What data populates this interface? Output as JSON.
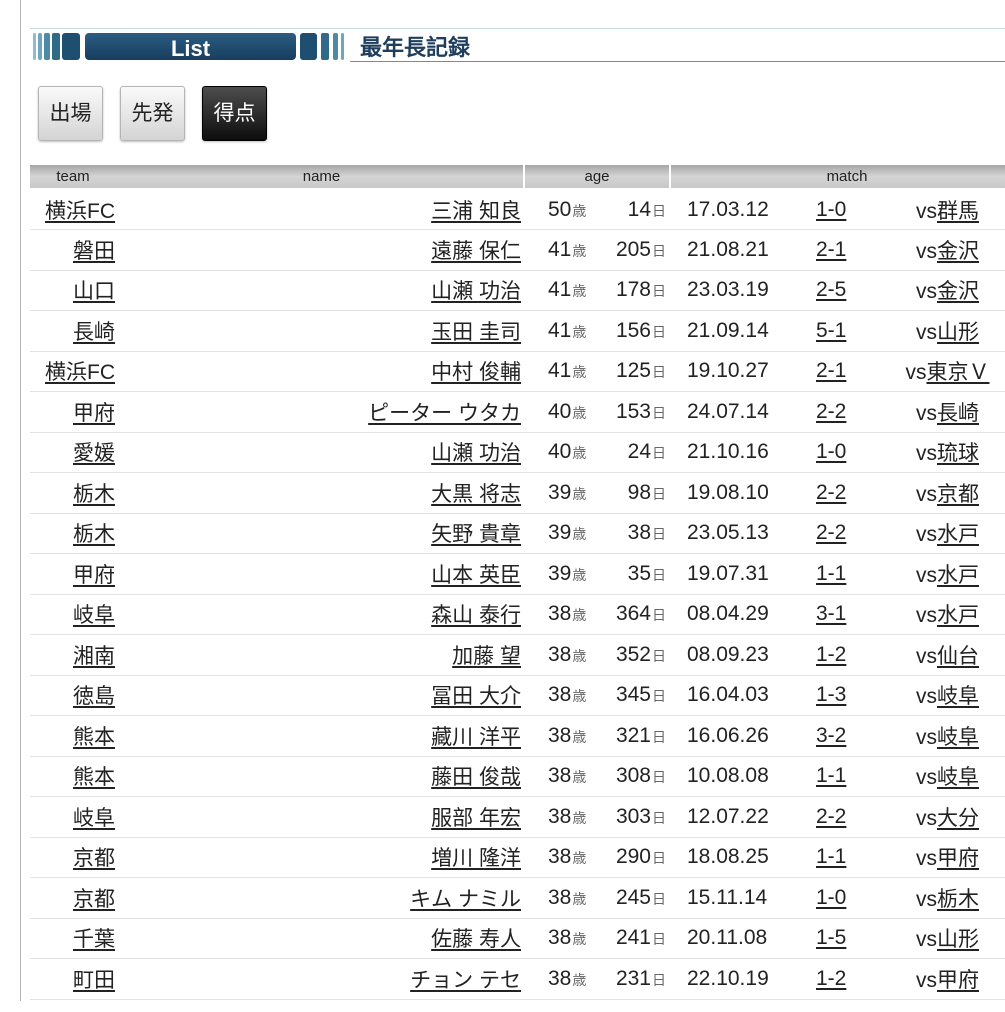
{
  "banner": {
    "label": "List",
    "title": "最年長記録"
  },
  "tabs": [
    {
      "label": "出場",
      "selected": false
    },
    {
      "label": "先発",
      "selected": false
    },
    {
      "label": "得点",
      "selected": true
    }
  ],
  "table": {
    "headers": {
      "team": "team",
      "name": "name",
      "age": "age",
      "match": "match"
    },
    "units": {
      "years": "歳",
      "days": "日"
    },
    "vs_prefix": "vs",
    "rows": [
      {
        "team": "横浜FC",
        "name": "三浦 知良",
        "years": "50",
        "days": "14",
        "date": "17.03.12",
        "score": "1-0",
        "opponent": "群馬"
      },
      {
        "team": "磐田",
        "name": "遠藤 保仁",
        "years": "41",
        "days": "205",
        "date": "21.08.21",
        "score": "2-1",
        "opponent": "金沢"
      },
      {
        "team": "山口",
        "name": "山瀬 功治",
        "years": "41",
        "days": "178",
        "date": "23.03.19",
        "score": "2-5",
        "opponent": "金沢"
      },
      {
        "team": "長崎",
        "name": "玉田 圭司",
        "years": "41",
        "days": "156",
        "date": "21.09.14",
        "score": "5-1",
        "opponent": "山形"
      },
      {
        "team": "横浜FC",
        "name": "中村 俊輔",
        "years": "41",
        "days": "125",
        "date": "19.10.27",
        "score": "2-1",
        "opponent": "東京Ｖ"
      },
      {
        "team": "甲府",
        "name": "ピーター ウタカ",
        "years": "40",
        "days": "153",
        "date": "24.07.14",
        "score": "2-2",
        "opponent": "長崎"
      },
      {
        "team": "愛媛",
        "name": "山瀬 功治",
        "years": "40",
        "days": "24",
        "date": "21.10.16",
        "score": "1-0",
        "opponent": "琉球"
      },
      {
        "team": "栃木",
        "name": "大黒 将志",
        "years": "39",
        "days": "98",
        "date": "19.08.10",
        "score": "2-2",
        "opponent": "京都"
      },
      {
        "team": "栃木",
        "name": "矢野 貴章",
        "years": "39",
        "days": "38",
        "date": "23.05.13",
        "score": "2-2",
        "opponent": "水戸"
      },
      {
        "team": "甲府",
        "name": "山本 英臣",
        "years": "39",
        "days": "35",
        "date": "19.07.31",
        "score": "1-1",
        "opponent": "水戸"
      },
      {
        "team": "岐阜",
        "name": "森山 泰行",
        "years": "38",
        "days": "364",
        "date": "08.04.29",
        "score": "3-1",
        "opponent": "水戸"
      },
      {
        "team": "湘南",
        "name": "加藤 望",
        "years": "38",
        "days": "352",
        "date": "08.09.23",
        "score": "1-2",
        "opponent": "仙台"
      },
      {
        "team": "徳島",
        "name": "冨田 大介",
        "years": "38",
        "days": "345",
        "date": "16.04.03",
        "score": "1-3",
        "opponent": "岐阜"
      },
      {
        "team": "熊本",
        "name": "藏川 洋平",
        "years": "38",
        "days": "321",
        "date": "16.06.26",
        "score": "3-2",
        "opponent": "岐阜"
      },
      {
        "team": "熊本",
        "name": "藤田 俊哉",
        "years": "38",
        "days": "308",
        "date": "10.08.08",
        "score": "1-1",
        "opponent": "岐阜"
      },
      {
        "team": "岐阜",
        "name": "服部 年宏",
        "years": "38",
        "days": "303",
        "date": "12.07.22",
        "score": "2-2",
        "opponent": "大分"
      },
      {
        "team": "京都",
        "name": "増川 隆洋",
        "years": "38",
        "days": "290",
        "date": "18.08.25",
        "score": "1-1",
        "opponent": "甲府"
      },
      {
        "team": "京都",
        "name": "キム ナミル",
        "years": "38",
        "days": "245",
        "date": "15.11.14",
        "score": "1-0",
        "opponent": "栃木"
      },
      {
        "team": "千葉",
        "name": "佐藤 寿人",
        "years": "38",
        "days": "241",
        "date": "20.11.08",
        "score": "1-5",
        "opponent": "山形"
      },
      {
        "team": "町田",
        "name": "チョン テセ",
        "years": "38",
        "days": "231",
        "date": "22.10.19",
        "score": "1-2",
        "opponent": "甲府"
      }
    ]
  },
  "colors": {
    "banner_navy": "#1b456a",
    "banner_teal": "#4d8aa3",
    "title_text": "#1f3d5c",
    "selected_tab_bg": "#1a1a1a",
    "header_gray": "#c8c8c8",
    "link_text": "#222222"
  }
}
